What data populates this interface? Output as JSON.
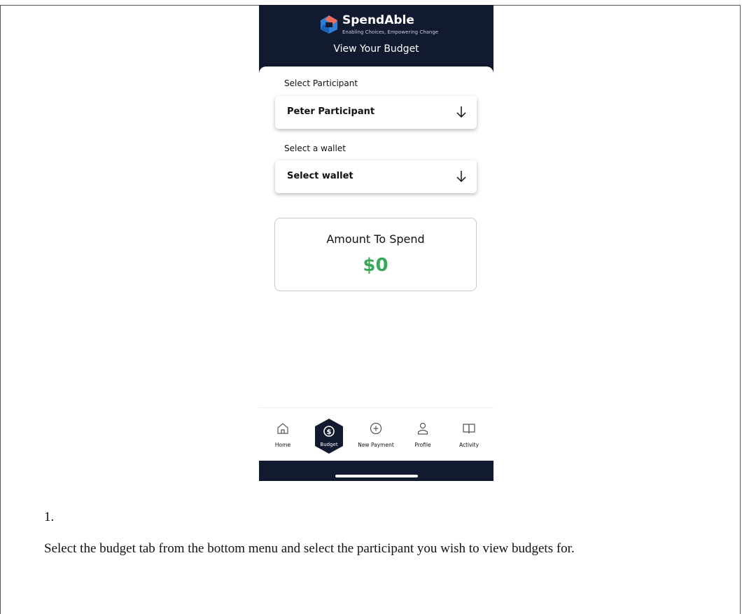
{
  "app": {
    "name": "SpendAble",
    "tagline": "Enabling Choices, Empowering Change",
    "screen_title": "View Your Budget"
  },
  "participant": {
    "label": "Select Participant",
    "value": "Peter Participant"
  },
  "wallet": {
    "label": "Select a wallet",
    "value": "Select wallet"
  },
  "amount": {
    "label": "Amount To Spend",
    "value": "$0",
    "color": "#3aa85b"
  },
  "tabs": [
    {
      "label": "Home",
      "icon": "home-icon"
    },
    {
      "label": "Budget",
      "icon": "dollar-icon",
      "active": true
    },
    {
      "label": "New Payment",
      "icon": "plus-circle-icon"
    },
    {
      "label": "Profile",
      "icon": "person-icon"
    },
    {
      "label": "Activity",
      "icon": "book-icon"
    }
  ],
  "instruction": {
    "number": "1.",
    "text": "Select the budget tab from the bottom menu and select the participant you wish to view budgets for."
  },
  "colors": {
    "header_bg": "#111a2e",
    "accent_green": "#3aa85b"
  }
}
